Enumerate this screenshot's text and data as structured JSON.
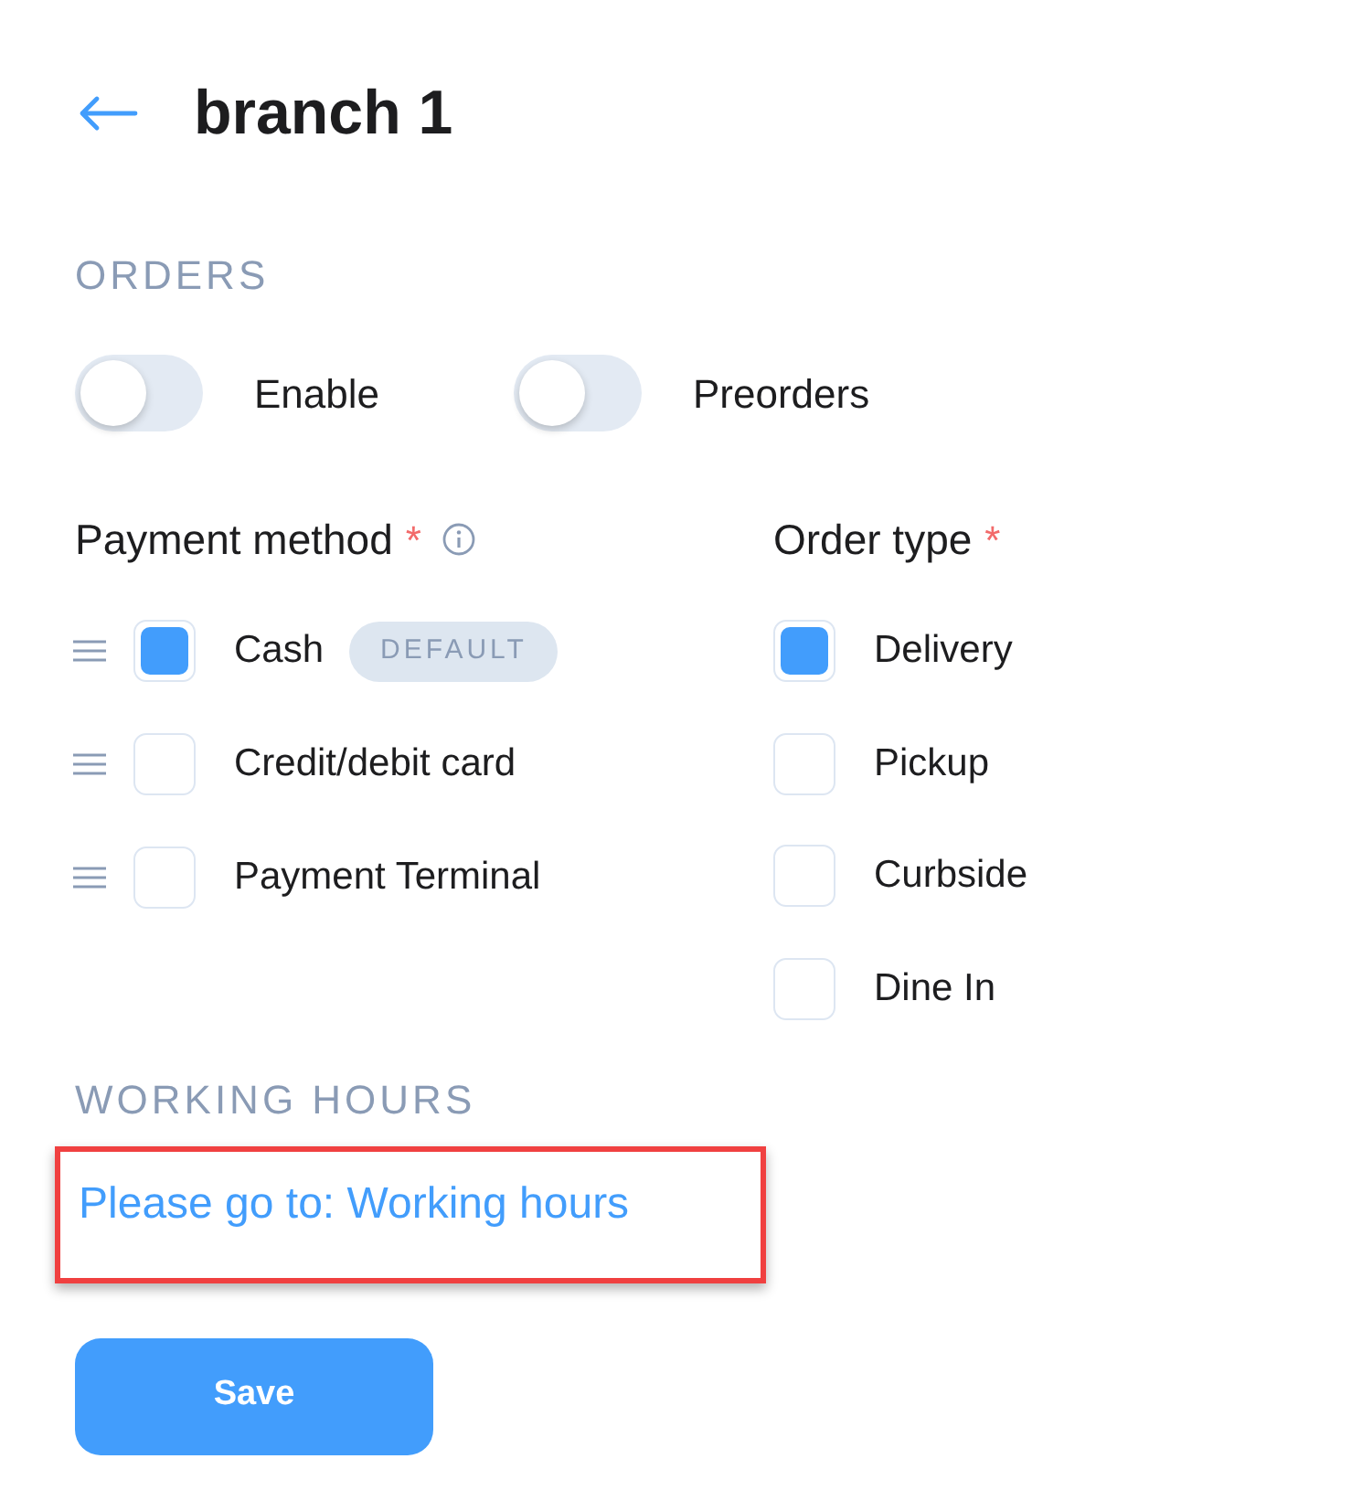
{
  "header": {
    "title": "branch 1"
  },
  "orders": {
    "heading": "ORDERS",
    "toggles": [
      {
        "label": "Enable",
        "on": false
      },
      {
        "label": "Preorders",
        "on": false
      }
    ]
  },
  "payment_method": {
    "heading": "Payment method",
    "required_mark": "*",
    "items": [
      {
        "label": "Cash",
        "checked": true,
        "badge": "DEFAULT"
      },
      {
        "label": "Credit/debit card",
        "checked": false
      },
      {
        "label": "Payment Terminal",
        "checked": false
      }
    ]
  },
  "order_type": {
    "heading": "Order type",
    "required_mark": "*",
    "items": [
      {
        "label": "Delivery",
        "checked": true
      },
      {
        "label": "Pickup",
        "checked": false
      },
      {
        "label": "Curbside",
        "checked": false
      },
      {
        "label": "Dine In",
        "checked": false
      }
    ]
  },
  "working_hours": {
    "heading": "WORKING HOURS",
    "link": "Please go to: Working hours",
    "highlighted": true
  },
  "save_button": "Save"
}
